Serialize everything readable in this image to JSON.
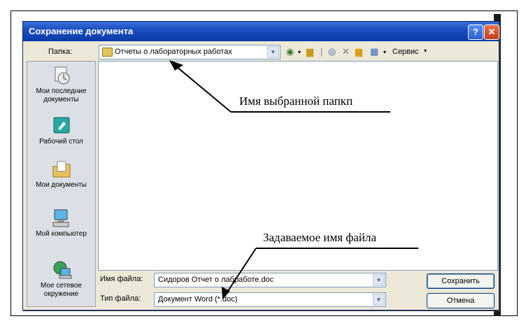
{
  "dialog": {
    "title": "Сохранение документа",
    "help_glyph": "?",
    "close_glyph": "✕"
  },
  "toolbar": {
    "folder_label": "Папка:",
    "folder_value": "Отчеты о лабораторных работах",
    "service_label": "Сервис",
    "icons": [
      "back-icon",
      "up-folder-icon",
      "search-web-icon",
      "delete-icon",
      "new-folder-icon",
      "views-icon"
    ]
  },
  "places": [
    {
      "label": "Мои последние документы",
      "icon": "recent-documents-icon"
    },
    {
      "label": "Рабочий стол",
      "icon": "desktop-icon"
    },
    {
      "label": "Мои документы",
      "icon": "my-documents-icon"
    },
    {
      "label": "Мой компьютер",
      "icon": "my-computer-icon"
    },
    {
      "label": "Мое сетевое окружение",
      "icon": "network-icon"
    }
  ],
  "filename": {
    "label": "Имя файла:",
    "value": "Сидоров Отчет о лабработе.doc"
  },
  "filetype": {
    "label": "Тип файла:",
    "value": "Документ Word (*.doc)"
  },
  "buttons": {
    "save": "Сохранить",
    "cancel": "Отмена"
  },
  "annotations": {
    "folder_note": "Имя выбранной папкп",
    "filename_note": "Задаваемое имя файла"
  },
  "colors": {
    "title_bar": "#1c4fbf",
    "dialog_bg": "#ece9d8",
    "places_bg": "#dcdfe6"
  }
}
